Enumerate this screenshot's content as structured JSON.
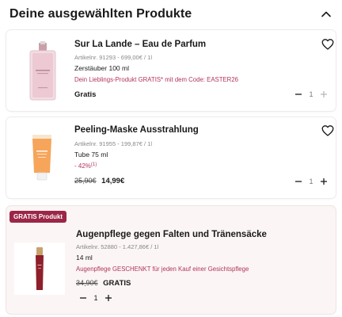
{
  "header": {
    "title": "Deine ausgewählten Produkte"
  },
  "products": [
    {
      "name": "Sur La Lande – Eau de Parfum",
      "meta": "Artikelnr. 91293 - 699,00€ / 1l",
      "size": "Zerstäuber 100 ml",
      "promo": "Dein Lieblings-Produkt GRATIS* mit dem Code: EASTER26",
      "price": "Gratis",
      "qty": "1"
    },
    {
      "name": "Peeling-Maske Ausstrahlung",
      "meta": "Artikelnr. 91955 - 199,87€ / 1l",
      "size": "Tube 75 ml",
      "discount": "- 42%",
      "discount_note": "(1)",
      "old_price": "25,90€",
      "price": "14,99€",
      "qty": "1"
    },
    {
      "badge": "GRATIS Produkt",
      "name": "Augenpflege gegen Falten und Tränensäcke",
      "meta": "Artikelnr. 52880 - 1.427,86€ / 1l",
      "size": "14 ml",
      "promo": "Augenpflege GESCHENKT für jeden Kauf einer Gesichtspflege",
      "old_price": "34,90€",
      "price": "GRATIS",
      "qty": "1"
    }
  ],
  "icons": {
    "collapse": "chevron-up-icon",
    "wishlist": "heart-outline-icon",
    "minus": "minus-icon",
    "plus": "plus-icon"
  },
  "colors": {
    "accent": "#9b2647",
    "promo_text": "#b2355a",
    "gift_card_bg": "#fbf5f5"
  }
}
